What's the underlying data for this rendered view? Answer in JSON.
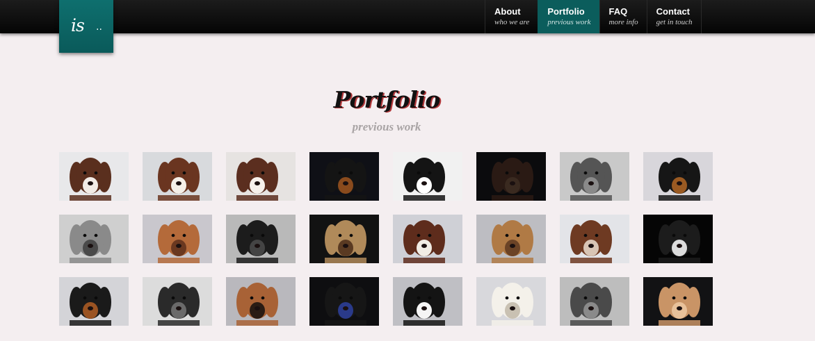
{
  "logo": {
    "text": "is",
    "dots": ".."
  },
  "nav": [
    {
      "title": "About",
      "sub": "who we are",
      "active": false
    },
    {
      "title": "Portfolio",
      "sub": "previous work",
      "active": true
    },
    {
      "title": "FAQ",
      "sub": "more info",
      "active": false
    },
    {
      "title": "Contact",
      "sub": "get in touch",
      "active": false
    }
  ],
  "page": {
    "title": "Portfolio",
    "subtitle": "previous work"
  },
  "colors": {
    "accent": "#0b5d5c",
    "background": "#f4eef0"
  },
  "gallery": [
    {
      "bg": "#e8e8ea",
      "fur": "#5a2f1e",
      "accent": "#f2ece6",
      "name": "dog-photo-1"
    },
    {
      "bg": "#d8dadd",
      "fur": "#6a3520",
      "accent": "#f4efe8",
      "name": "dog-photo-2"
    },
    {
      "bg": "#e6e3e1",
      "fur": "#5b2e1f",
      "accent": "#f6f1ec",
      "name": "dog-photo-3"
    },
    {
      "bg": "#0f1016",
      "fur": "#141414",
      "accent": "#8a4b1d",
      "name": "dog-photo-4"
    },
    {
      "bg": "#f1f1f1",
      "fur": "#141414",
      "accent": "#ffffff",
      "name": "dog-photo-5"
    },
    {
      "bg": "#0b0b0d",
      "fur": "#2a1a14",
      "accent": "#3a2a20",
      "name": "dog-photo-6"
    },
    {
      "bg": "#c9c9c9",
      "fur": "#555555",
      "accent": "#8a8a8a",
      "name": "dog-photo-7"
    },
    {
      "bg": "#d8d6db",
      "fur": "#161616",
      "accent": "#9a5a22",
      "name": "dog-photo-8"
    },
    {
      "bg": "#cfcfcf",
      "fur": "#8a8a8a",
      "accent": "#4a4a4a",
      "name": "dog-photo-9"
    },
    {
      "bg": "#c9c7cd",
      "fur": "#b46a3a",
      "accent": "#6a3820",
      "name": "dog-photo-10"
    },
    {
      "bg": "#b9b9b9",
      "fur": "#1c1c1c",
      "accent": "#444444",
      "name": "dog-photo-11"
    },
    {
      "bg": "#121212",
      "fur": "#b08a5a",
      "accent": "#5a3a22",
      "name": "dog-photo-12"
    },
    {
      "bg": "#cfd0d6",
      "fur": "#5e2c1c",
      "accent": "#f1ece4",
      "name": "dog-photo-13"
    },
    {
      "bg": "#bdbdc2",
      "fur": "#b07a45",
      "accent": "#6b4326",
      "name": "dog-photo-14"
    },
    {
      "bg": "#e3e4e8",
      "fur": "#6e3a22",
      "accent": "#d8c5b5",
      "name": "dog-photo-15"
    },
    {
      "bg": "#050505",
      "fur": "#1c1c1c",
      "accent": "#dcdcdc",
      "name": "dog-photo-16"
    },
    {
      "bg": "#d4d4d8",
      "fur": "#1a1a1a",
      "accent": "#9a5322",
      "name": "dog-photo-17"
    },
    {
      "bg": "#dcdcdc",
      "fur": "#2a2a2a",
      "accent": "#6a6a6a",
      "name": "dog-photo-18"
    },
    {
      "bg": "#b9b8bd",
      "fur": "#a86236",
      "accent": "#2a1c14",
      "name": "dog-photo-19"
    },
    {
      "bg": "#0e0e10",
      "fur": "#161616",
      "accent": "#2a3a8a",
      "name": "dog-photo-20"
    },
    {
      "bg": "#bfbfc4",
      "fur": "#141414",
      "accent": "#f5f5f5",
      "name": "dog-photo-21"
    },
    {
      "bg": "#d8d8dc",
      "fur": "#f4f1ea",
      "accent": "#c9c1b2",
      "name": "dog-photo-22"
    },
    {
      "bg": "#bdbdbd",
      "fur": "#4a4a4a",
      "accent": "#8a8a8a",
      "name": "dog-photo-23"
    },
    {
      "bg": "#121214",
      "fur": "#c99466",
      "accent": "#e8c19a",
      "name": "dog-photo-24"
    }
  ]
}
